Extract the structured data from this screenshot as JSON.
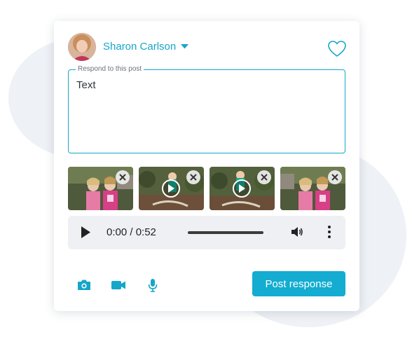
{
  "user": {
    "name": "Sharon Carlson"
  },
  "response": {
    "legend": "Respond to this post",
    "value": "Text"
  },
  "attachments": [
    {
      "type": "photo"
    },
    {
      "type": "video"
    },
    {
      "type": "video"
    },
    {
      "type": "photo"
    }
  ],
  "audio": {
    "time": "0:00 / 0:52"
  },
  "actions": {
    "post_label": "Post response"
  },
  "colors": {
    "accent": "#16a6c9",
    "button": "#14acd1",
    "blob": "#eef1f6"
  },
  "icons": [
    "caret-down-icon",
    "heart-icon",
    "close-icon",
    "play-icon",
    "volume-icon",
    "more-vertical-icon",
    "camera-icon",
    "video-camera-icon",
    "microphone-icon"
  ]
}
